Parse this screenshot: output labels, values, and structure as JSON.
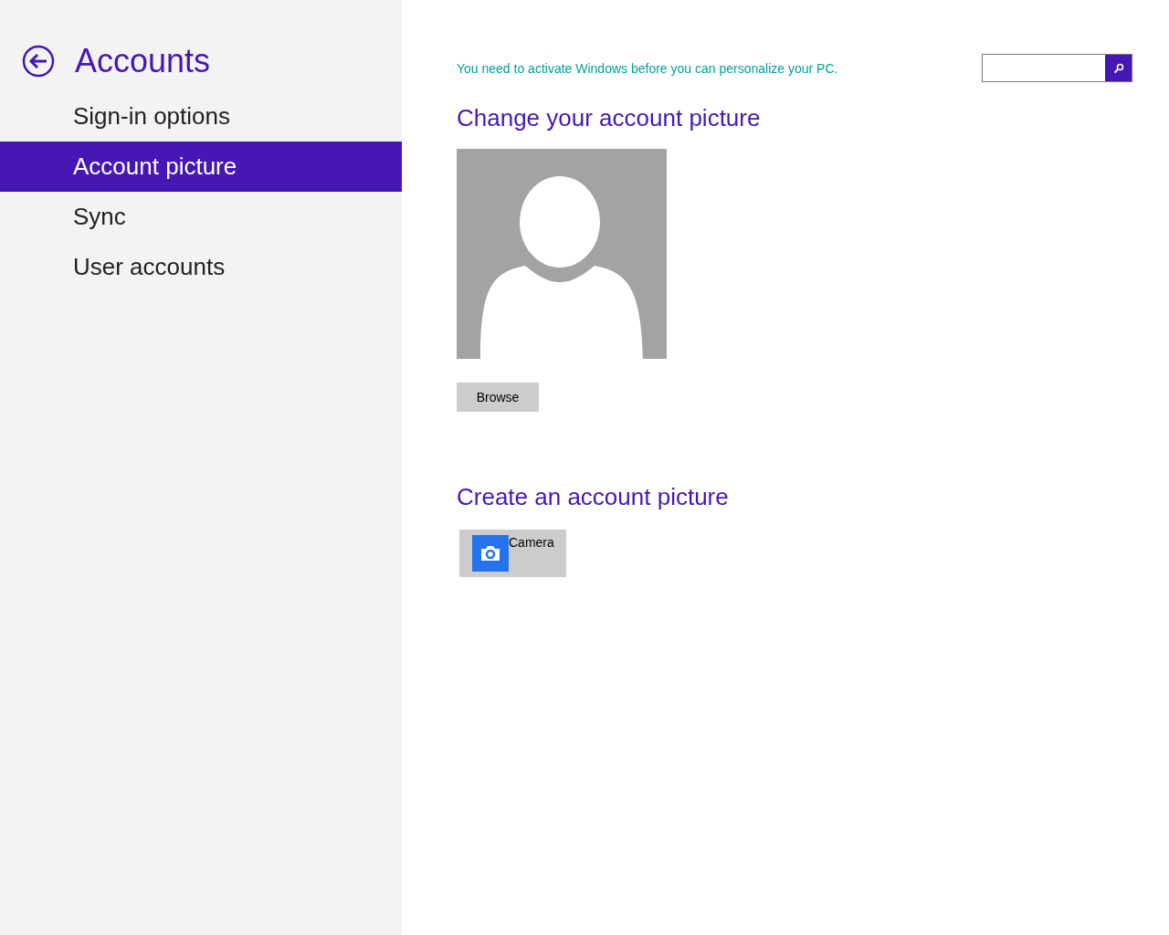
{
  "sidebar": {
    "title": "Accounts",
    "items": [
      {
        "label": "Sign-in options",
        "selected": false
      },
      {
        "label": "Account picture",
        "selected": true
      },
      {
        "label": "Sync",
        "selected": false
      },
      {
        "label": "User accounts",
        "selected": false
      }
    ]
  },
  "notice": "You need to activate Windows before you can personalize your PC.",
  "change_section": {
    "heading": "Change your account picture",
    "button": "Browse"
  },
  "create_section": {
    "heading": "Create an account picture",
    "apps": [
      {
        "label": "Camera"
      }
    ]
  }
}
